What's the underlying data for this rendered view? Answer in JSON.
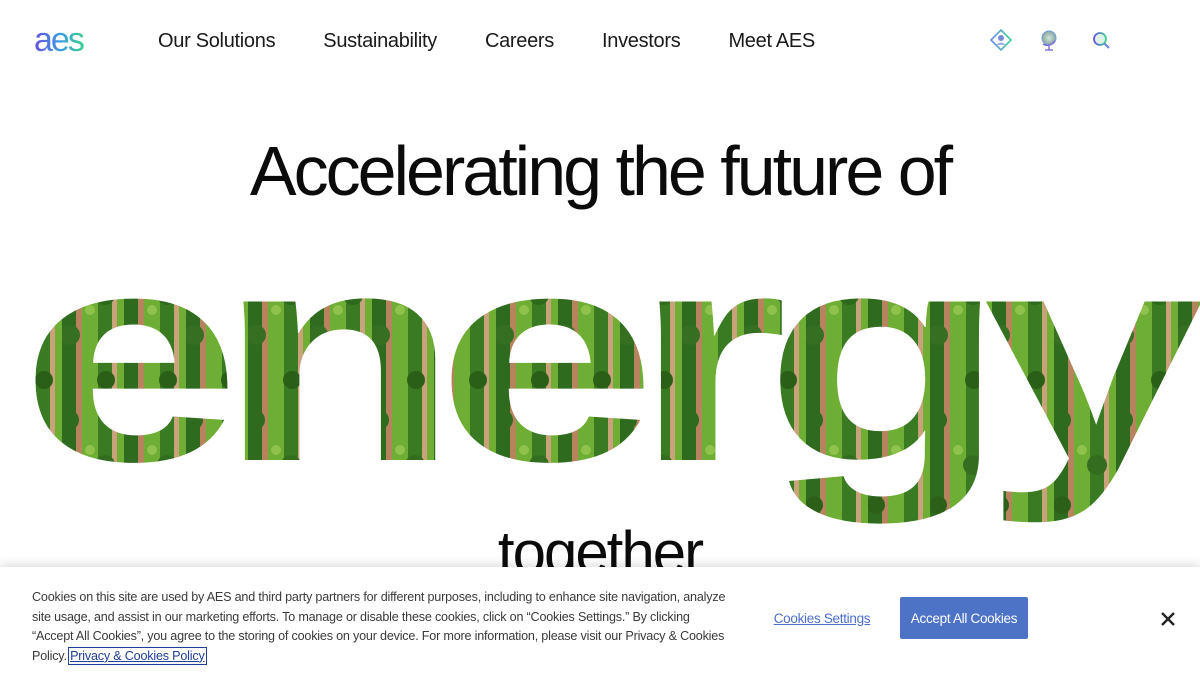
{
  "header": {
    "logo_text": "aes",
    "nav": [
      {
        "label": "Our Solutions"
      },
      {
        "label": "Sustainability"
      },
      {
        "label": "Careers"
      },
      {
        "label": "Investors"
      },
      {
        "label": "Meet AES"
      }
    ],
    "utility_icons": [
      "user-icon",
      "globe-icon",
      "search-icon"
    ]
  },
  "hero": {
    "line1": "Accelerating the future of",
    "word": "energy",
    "line2": "together"
  },
  "cookie_banner": {
    "text": "Cookies on this site are used by AES and third party partners for different purposes, including to enhance site navigation, analyze site usage, and assist in our marketing efforts. To manage or disable these cookies, click on “Cookies Settings.” By clicking “Accept All Cookies”, you agree to the storing of cookies on your device. For more information, please visit our Privacy & Cookies Policy.",
    "policy_link": "Privacy & Cookies Policy",
    "settings_label": "Cookies Settings",
    "accept_label": "Accept All Cookies"
  },
  "colors": {
    "accent_blue": "#4c73c5",
    "logo_gradient": [
      "#6b4fe0",
      "#3aa0e0",
      "#3ccf8e"
    ],
    "field_green": "#5a9a2e"
  }
}
